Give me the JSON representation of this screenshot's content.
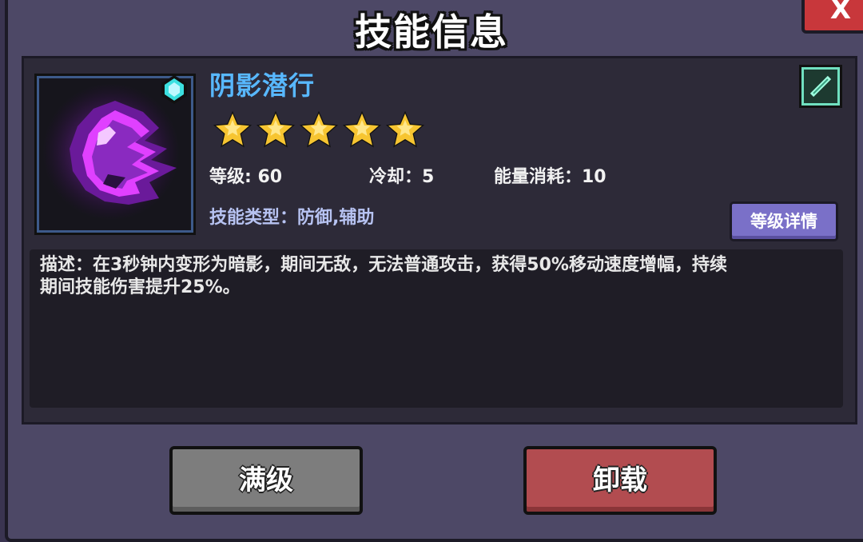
{
  "dialog": {
    "title": "技能信息",
    "close_label": "X"
  },
  "skill": {
    "name": "阴影潜行",
    "stars": 5,
    "level_label": "等级: 60",
    "cooldown_label": "冷却：5",
    "energy_label": "能量消耗：10",
    "type_label": "技能类型：防御,辅助",
    "description_line1": "描述：在3秒钟内变形为暗影，期间无敌，无法普通攻击，获得50%移动速度增幅，持续",
    "description_line2": "期间技能伤害提升25%。",
    "icon": "shadow-orb-icon",
    "gem_icon": "cyan-gem-icon"
  },
  "buttons": {
    "level_detail": "等级详情",
    "max_level": "满级",
    "unload": "卸载"
  },
  "colors": {
    "skill_name": "#58b8ff",
    "panel": "#2d2a38",
    "unload_button": "#b24c50",
    "max_button": "#7d7d7d",
    "detail_button": "#7a70c8"
  }
}
